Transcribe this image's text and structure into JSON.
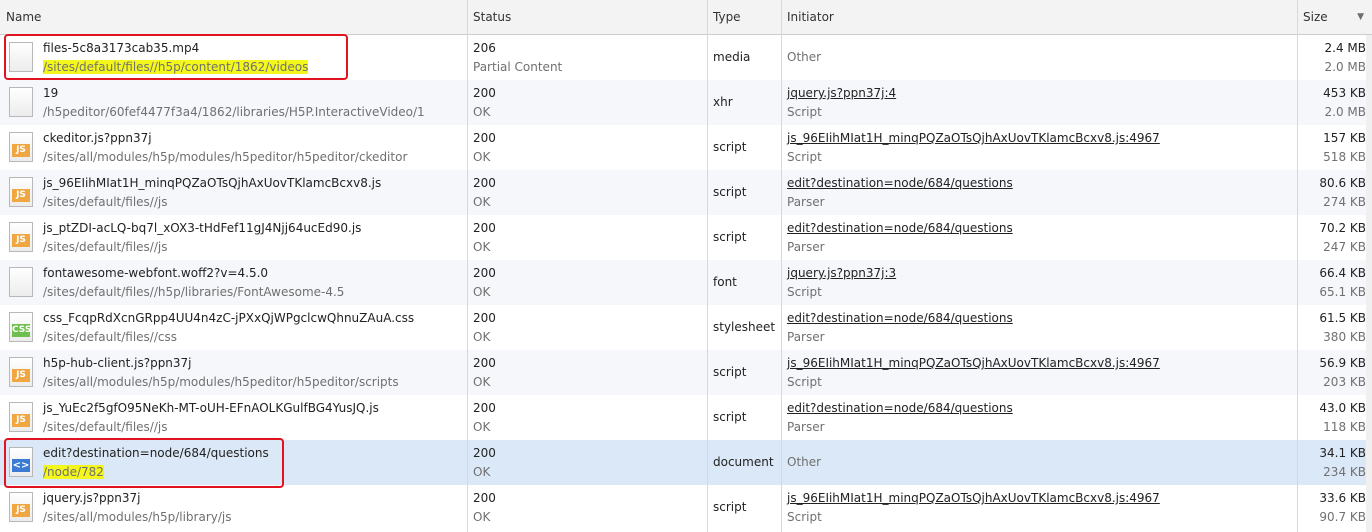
{
  "columns": {
    "name": "Name",
    "status": "Status",
    "type": "Type",
    "initiator": "Initiator",
    "size": "Size"
  },
  "rows": [
    {
      "icon": "blank-file-icon",
      "name": "files-5c8a3173cab35.mp4",
      "path": "/sites/default/files//h5p/content/1862/videos",
      "status": "206",
      "status_text": "Partial Content",
      "type": "media",
      "initiator": "Other",
      "initiator_sub": "",
      "size": "2.4 MB",
      "size_sub": "2.0 MB"
    },
    {
      "icon": "blank-file-icon",
      "name": "19",
      "path": "/h5peditor/60fef4477f3a4/1862/libraries/H5P.InteractiveVideo/1",
      "status": "200",
      "status_text": "OK",
      "type": "xhr",
      "initiator": "jquery.js?ppn37j:4",
      "initiator_sub": "Script",
      "size": "453 KB",
      "size_sub": "2.0 MB"
    },
    {
      "icon": "js-file-icon",
      "name": "ckeditor.js?ppn37j",
      "path": "/sites/all/modules/h5p/modules/h5peditor/h5peditor/ckeditor",
      "status": "200",
      "status_text": "OK",
      "type": "script",
      "initiator": "js_96EIihMIat1H_minqPQZaOTsQjhAxUovTKlamcBcxv8.js:4967",
      "initiator_sub": "Script",
      "size": "157 KB",
      "size_sub": "518 KB"
    },
    {
      "icon": "js-file-icon",
      "name": "js_96EIihMIat1H_minqPQZaOTsQjhAxUovTKlamcBcxv8.js",
      "path": "/sites/default/files//js",
      "status": "200",
      "status_text": "OK",
      "type": "script",
      "initiator": "edit?destination=node/684/questions",
      "initiator_sub": "Parser",
      "size": "80.6 KB",
      "size_sub": "274 KB"
    },
    {
      "icon": "js-file-icon",
      "name": "js_ptZDI-acLQ-bq7l_xOX3-tHdFef11gJ4Njj64ucEd90.js",
      "path": "/sites/default/files//js",
      "status": "200",
      "status_text": "OK",
      "type": "script",
      "initiator": "edit?destination=node/684/questions",
      "initiator_sub": "Parser",
      "size": "70.2 KB",
      "size_sub": "247 KB"
    },
    {
      "icon": "blank-file-icon",
      "name": "fontawesome-webfont.woff2?v=4.5.0",
      "path": "/sites/default/files//h5p/libraries/FontAwesome-4.5",
      "status": "200",
      "status_text": "OK",
      "type": "font",
      "initiator": "jquery.js?ppn37j:3",
      "initiator_sub": "Script",
      "size": "66.4 KB",
      "size_sub": "65.1 KB"
    },
    {
      "icon": "css-file-icon",
      "name": "css_FcqpRdXcnGRpp4UU4n4zC-jPXxQjWPgclcwQhnuZAuA.css",
      "path": "/sites/default/files//css",
      "status": "200",
      "status_text": "OK",
      "type": "stylesheet",
      "initiator": "edit?destination=node/684/questions",
      "initiator_sub": "Parser",
      "size": "61.5 KB",
      "size_sub": "380 KB"
    },
    {
      "icon": "js-file-icon",
      "name": "h5p-hub-client.js?ppn37j",
      "path": "/sites/all/modules/h5p/modules/h5peditor/h5peditor/scripts",
      "status": "200",
      "status_text": "OK",
      "type": "script",
      "initiator": "js_96EIihMIat1H_minqPQZaOTsQjhAxUovTKlamcBcxv8.js:4967",
      "initiator_sub": "Script",
      "size": "56.9 KB",
      "size_sub": "203 KB"
    },
    {
      "icon": "js-file-icon",
      "name": "js_YuEc2f5gfO95NeKh-MT-oUH-EFnAOLKGulfBG4YusJQ.js",
      "path": "/sites/default/files//js",
      "status": "200",
      "status_text": "OK",
      "type": "script",
      "initiator": "edit?destination=node/684/questions",
      "initiator_sub": "Parser",
      "size": "43.0 KB",
      "size_sub": "118 KB"
    },
    {
      "icon": "document-file-icon",
      "name": "edit?destination=node/684/questions",
      "path": "/node/782",
      "status": "200",
      "status_text": "OK",
      "type": "document",
      "initiator": "Other",
      "initiator_sub": "",
      "size": "34.1 KB",
      "size_sub": "234 KB"
    },
    {
      "icon": "js-file-icon",
      "name": "jquery.js?ppn37j",
      "path": "/sites/all/modules/h5p/library/js",
      "status": "200",
      "status_text": "OK",
      "type": "script",
      "initiator": "js_96EIihMIat1H_minqPQZaOTsQjhAxUovTKlamcBcxv8.js:4967",
      "initiator_sub": "Script",
      "size": "33.6 KB",
      "size_sub": "90.7 KB"
    }
  ]
}
